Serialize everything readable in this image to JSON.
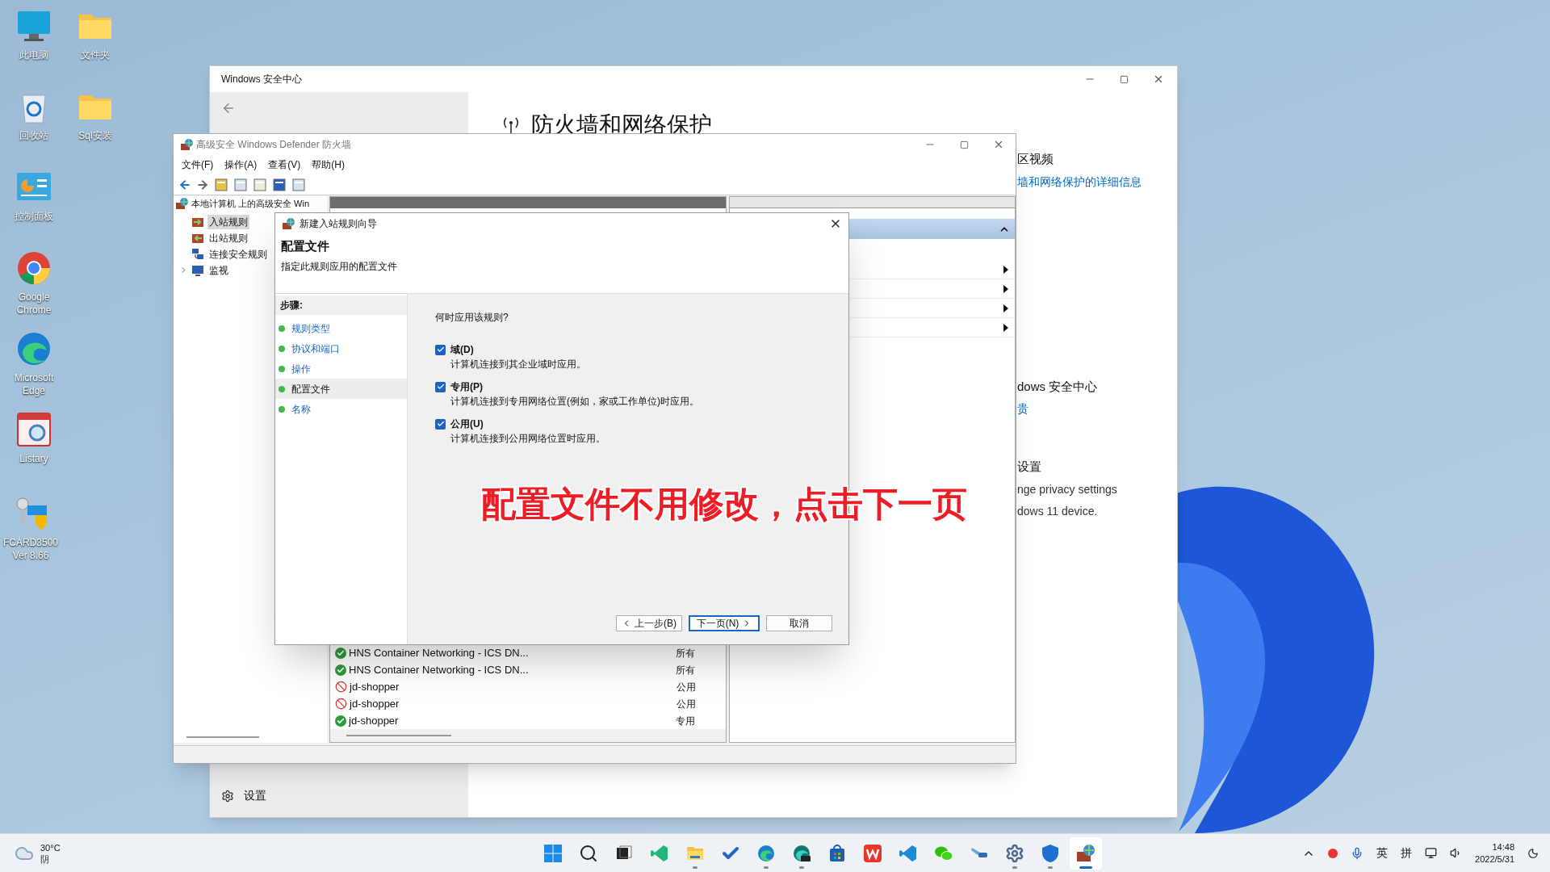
{
  "desktop_icons": [
    {
      "label": "此电脑",
      "kind": "monitor"
    },
    {
      "label": "文件夹",
      "kind": "folder"
    },
    {
      "label": "回收站",
      "kind": "recycle"
    },
    {
      "label": "Sql安装",
      "kind": "folder"
    },
    {
      "label": "控制面板",
      "kind": "control"
    },
    {
      "label": "Google Chrome",
      "kind": "chrome"
    },
    {
      "label": "Microsoft Edge",
      "kind": "edge"
    },
    {
      "label": "Listary",
      "kind": "listary"
    },
    {
      "label": "FCARD3500 Ver 8.66",
      "kind": "keys"
    }
  ],
  "security_center": {
    "title": "Windows 安全中心",
    "heading": "防火墙和网络保护",
    "settings": "设置",
    "side_sections": [
      {
        "title": "区视频",
        "lines": [
          {
            "text": "墙和网络保护的详细信息",
            "kind": "link"
          }
        ]
      },
      {
        "title": "dows 安全中心",
        "lines": [
          {
            "text": "贵",
            "kind": "link"
          }
        ]
      },
      {
        "title": "设置",
        "lines": [
          {
            "text": "nge privacy settings",
            "kind": "text"
          },
          {
            "text": "dows 11 device.",
            "kind": "text"
          }
        ]
      }
    ]
  },
  "firewall": {
    "title": "高级安全 Windows Defender 防火墙",
    "menus": [
      "文件(F)",
      "操作(A)",
      "查看(V)",
      "帮助(H)"
    ],
    "tree": {
      "label": "本地计算机 上的高级安全 Win",
      "children": [
        {
          "label": "入站规则",
          "kind": "inbound",
          "selected": true
        },
        {
          "label": "出站规则",
          "kind": "outbound",
          "selected": false
        },
        {
          "label": "连接安全规则",
          "kind": "security",
          "selected": false
        },
        {
          "label": "监视",
          "kind": "monitor",
          "selected": false,
          "expanded": false
        }
      ]
    },
    "rules": [
      {
        "name": "HNS Container Networking - ICS DN...",
        "profile": "所有",
        "kind": "allow"
      },
      {
        "name": "HNS Container Networking - ICS DN...",
        "profile": "所有",
        "kind": "allow"
      },
      {
        "name": "jd-shopper",
        "profile": "公用",
        "kind": "block"
      },
      {
        "name": "jd-shopper",
        "profile": "公用",
        "kind": "block"
      },
      {
        "name": "jd-shopper",
        "profile": "专用",
        "kind": "allow"
      }
    ]
  },
  "wizard": {
    "title": "新建入站规则向导",
    "heading": "配置文件",
    "subtitle": "指定此规则应用的配置文件",
    "steps_label": "步骤:",
    "steps": [
      {
        "label": "规则类型",
        "selected": false
      },
      {
        "label": "协议和端口",
        "selected": false
      },
      {
        "label": "操作",
        "selected": false
      },
      {
        "label": "配置文件",
        "selected": true
      },
      {
        "label": "名称",
        "selected": false
      }
    ],
    "question": "何时应用该规则?",
    "options": [
      {
        "label": "域(D)",
        "description": "计算机连接到其企业域时应用。",
        "checked": true
      },
      {
        "label": "专用(P)",
        "description": "计算机连接到专用网络位置(例如，家或工作单位)时应用。",
        "checked": true
      },
      {
        "label": "公用(U)",
        "description": "计算机连接到公用网络位置时应用。",
        "checked": true
      }
    ],
    "buttons": [
      {
        "label": "上一步(B)",
        "kind": "back"
      },
      {
        "label": "下一页(N)",
        "kind": "next"
      },
      {
        "label": "取消",
        "kind": "cancel"
      }
    ]
  },
  "caption": "配置文件不用修改，点击下一页",
  "taskbar": {
    "weather": {
      "temp": "30°C",
      "condition": "阴"
    },
    "apps": [
      {
        "kind": "start",
        "active": false,
        "running": false
      },
      {
        "kind": "search",
        "active": false,
        "running": false
      },
      {
        "kind": "taskview",
        "active": false,
        "running": false
      },
      {
        "kind": "code-green",
        "active": false,
        "running": false
      },
      {
        "kind": "explorer",
        "active": false,
        "running": true
      },
      {
        "kind": "todo",
        "active": false,
        "running": false
      },
      {
        "kind": "edge",
        "active": false,
        "running": true
      },
      {
        "kind": "edge-dev",
        "active": false,
        "running": true
      },
      {
        "kind": "store",
        "active": false,
        "running": false
      },
      {
        "kind": "wps",
        "active": false,
        "running": false
      },
      {
        "kind": "vscode",
        "active": false,
        "running": false
      },
      {
        "kind": "wechat",
        "active": false,
        "running": false
      },
      {
        "kind": "tool",
        "active": false,
        "running": false
      },
      {
        "kind": "settings",
        "active": false,
        "running": true
      },
      {
        "kind": "defender",
        "active": false,
        "running": true
      },
      {
        "kind": "firewall",
        "active": true
      }
    ],
    "ime": [
      "英",
      "拼"
    ],
    "time": "14:48",
    "date": "2022/5/31"
  }
}
